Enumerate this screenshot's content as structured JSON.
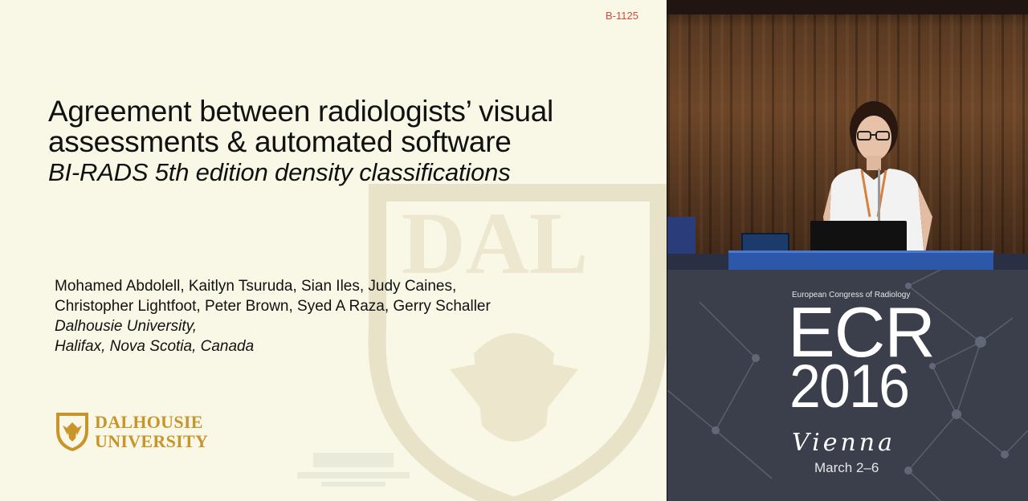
{
  "slide": {
    "code": "B-1125",
    "title_line1": "Agreement between radiologists’ visual",
    "title_line2": "assessments & automated software",
    "subtitle": "BI-RADS 5th edition density classifications",
    "authors_line1": "Mohamed Abdolell, Kaitlyn Tsuruda, Sian Iles, Judy Caines,",
    "authors_line2": "Christopher Lightfoot, Peter Brown, Syed A Raza, Gerry Schaller",
    "affiliation_line1": "Dalhousie University,",
    "affiliation_line2": "Halifax, Nova Scotia, Canada",
    "logo_line1": "DALHOUSIE",
    "logo_line2": "UNIVERSITY",
    "watermark_text": "DAL"
  },
  "camera": {
    "icon": "speaker-video-icon"
  },
  "ecr": {
    "congress": "European Congress of Radiology",
    "logo": "ECR",
    "year": "2016",
    "city": "Vienna",
    "dates": "March 2–6"
  },
  "colors": {
    "slide_bg": "#f9f8e6",
    "code_red": "#d44a3a",
    "logo_gold": "#c9952a",
    "ecr_bg": "#3b3f4c"
  }
}
